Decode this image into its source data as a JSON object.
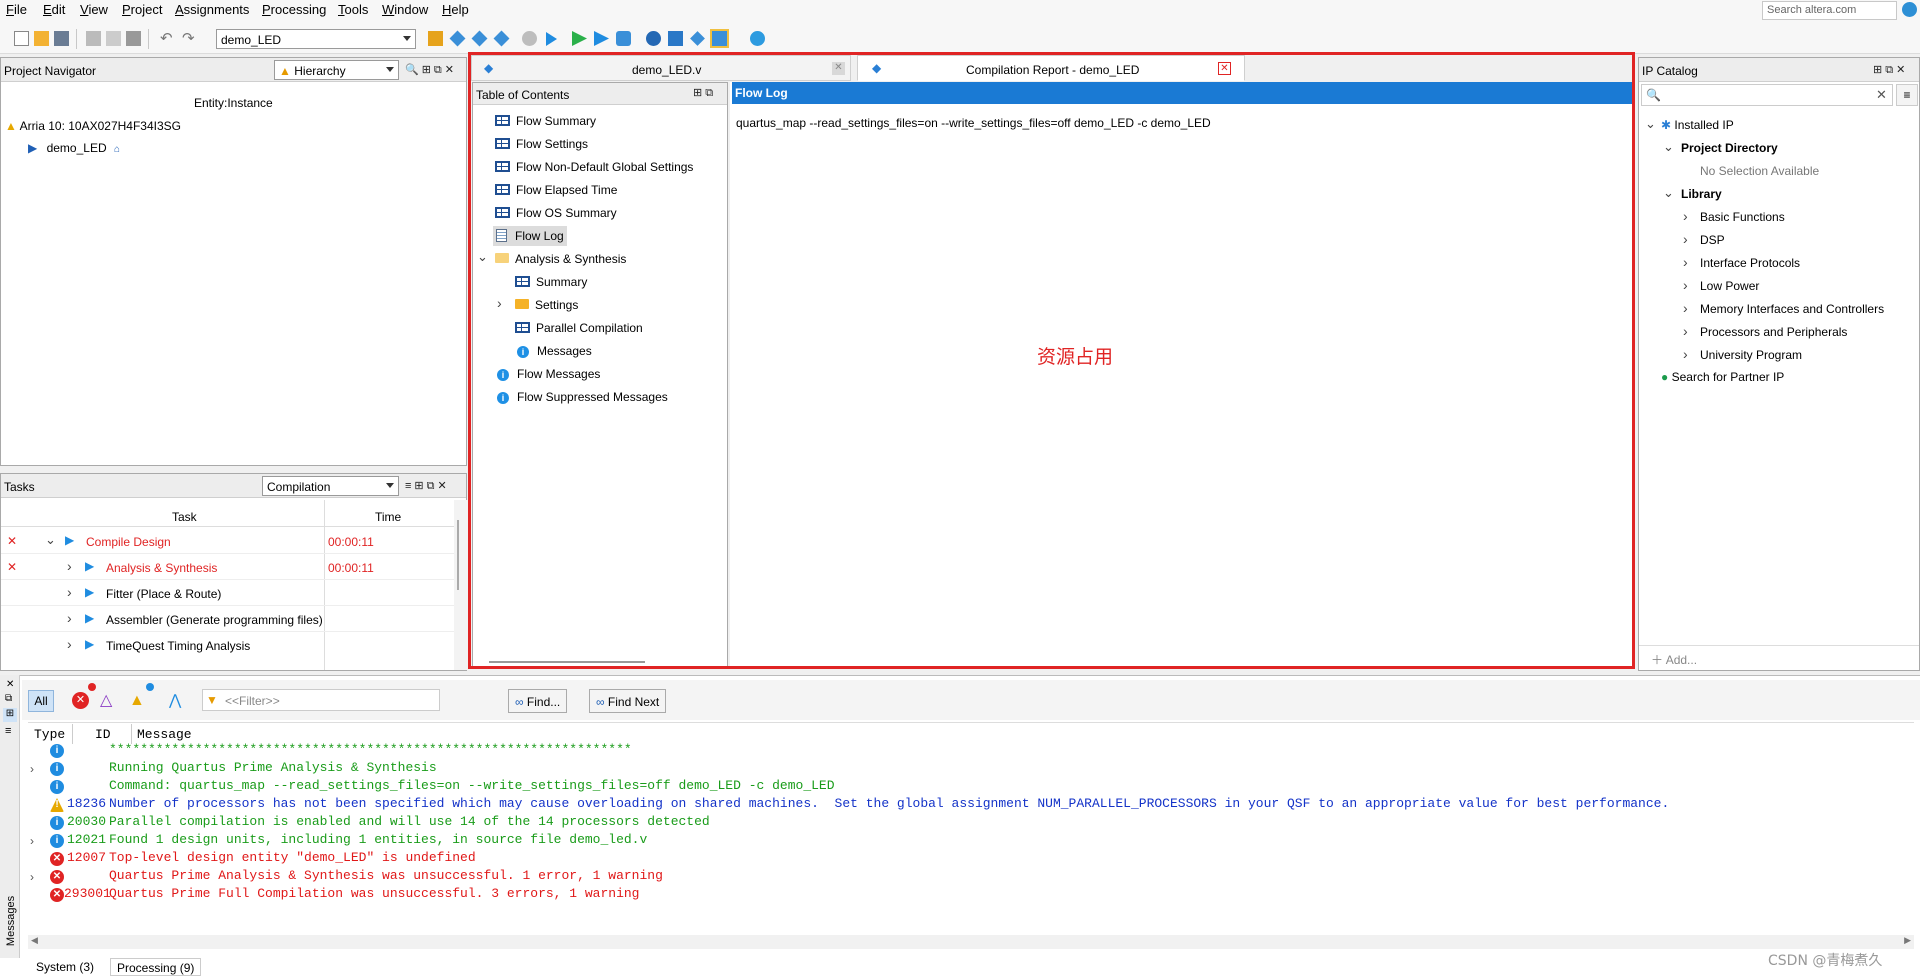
{
  "menu": [
    "File",
    "Edit",
    "View",
    "Project",
    "Assignments",
    "Processing",
    "Tools",
    "Window",
    "Help"
  ],
  "search_placeholder": "Search altera.com",
  "revision": "demo_LED",
  "project_navigator": {
    "title": "Project Navigator",
    "view": "Hierarchy",
    "column": "Entity:Instance",
    "device": "Arria 10: 10AX027H4F34I3SG",
    "top_entity": "demo_LED"
  },
  "tasks": {
    "title": "Tasks",
    "flow": "Compilation",
    "col_task": "Task",
    "col_time": "Time",
    "rows": [
      {
        "name": "Compile Design",
        "time": "00:00:11",
        "status": "failed"
      },
      {
        "name": "Analysis & Synthesis",
        "time": "00:00:11",
        "status": "failed"
      },
      {
        "name": "Fitter (Place & Route)",
        "time": "",
        "status": ""
      },
      {
        "name": "Assembler (Generate programming files)",
        "time": "",
        "status": ""
      },
      {
        "name": "TimeQuest Timing Analysis",
        "time": "",
        "status": ""
      }
    ]
  },
  "doc_tabs": [
    "demo_LED.v",
    "Compilation Report - demo_LED"
  ],
  "toc": {
    "title": "Table of Contents",
    "items": [
      "Flow Summary",
      "Flow Settings",
      "Flow Non-Default Global Settings",
      "Flow Elapsed Time",
      "Flow OS Summary",
      "Flow Log",
      "Analysis & Synthesis",
      "Summary",
      "Settings",
      "Parallel Compilation",
      "Messages",
      "Flow Messages",
      "Flow Suppressed Messages"
    ]
  },
  "flow_log": {
    "title": "Flow Log",
    "command": "quartus_map --read_settings_files=on --write_settings_files=off demo_LED -c demo_LED",
    "annotation": "资源占用"
  },
  "ip_catalog": {
    "title": "IP Catalog",
    "installed": "Installed IP",
    "project_dir": "Project Directory",
    "no_selection": "No Selection Available",
    "library": "Library",
    "library_items": [
      "Basic Functions",
      "DSP",
      "Interface Protocols",
      "Low Power",
      "Memory Interfaces and Controllers",
      "Processors and Peripherals",
      "University Program"
    ],
    "partner": "Search for Partner IP",
    "add": "Add..."
  },
  "messages": {
    "filter_placeholder": "<<Filter>>",
    "all": "All",
    "find": "Find...",
    "find_next": "Find Next",
    "col_type": "Type",
    "col_id": "ID",
    "col_message": "Message",
    "side_label": "Messages",
    "lines": [
      {
        "icon": "info",
        "id": "",
        "text": "*******************************************************************",
        "color": "#1a9c1a",
        "exp": false
      },
      {
        "icon": "info",
        "id": "",
        "text": "Running Quartus Prime Analysis & Synthesis",
        "color": "#1a9c1a",
        "exp": true
      },
      {
        "icon": "info",
        "id": "",
        "text": "Command: quartus_map --read_settings_files=on --write_settings_files=off demo_LED -c demo_LED",
        "color": "#1a9c1a",
        "exp": false
      },
      {
        "icon": "warn",
        "id": "18236",
        "text": "Number of processors has not been specified which may cause overloading on shared machines.  Set the global assignment NUM_PARALLEL_PROCESSORS in your QSF to an appropriate value for best performance.",
        "color": "#1433c8",
        "exp": false
      },
      {
        "icon": "info",
        "id": "20030",
        "text": "Parallel compilation is enabled and will use 14 of the 14 processors detected",
        "color": "#1a9c1a",
        "exp": false
      },
      {
        "icon": "info",
        "id": "12021",
        "text": "Found 1 design units, including 1 entities, in source file demo_led.v",
        "color": "#1a9c1a",
        "exp": true
      },
      {
        "icon": "err",
        "id": "12007",
        "text": "Top-level design entity \"demo_LED\" is undefined",
        "color": "#e01818",
        "exp": false
      },
      {
        "icon": "err",
        "id": "",
        "text": "Quartus Prime Analysis & Synthesis was unsuccessful. 1 error, 1 warning",
        "color": "#e01818",
        "exp": true
      },
      {
        "icon": "err",
        "id": "293001",
        "text": "Quartus Prime Full Compilation was unsuccessful. 3 errors, 1 warning",
        "color": "#e01818",
        "exp": false
      }
    ]
  },
  "status_tabs": [
    "System (3)",
    "Processing (9)"
  ],
  "watermark": "CSDN @青梅煮久"
}
